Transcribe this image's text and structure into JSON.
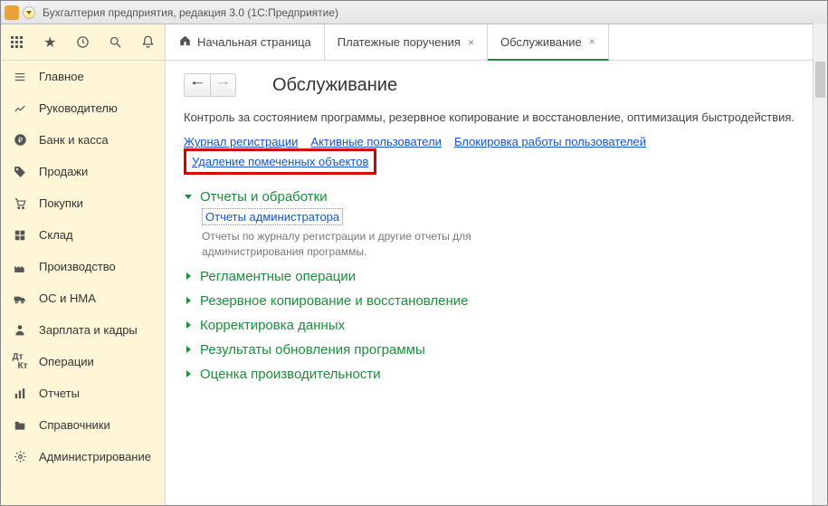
{
  "window": {
    "title": "Бухгалтерия предприятия, редакция 3.0   (1С:Предприятие)"
  },
  "sidebar": {
    "toolbar": [
      "apps",
      "star",
      "history",
      "search",
      "bell"
    ],
    "items": [
      {
        "icon": "menu",
        "label": "Главное"
      },
      {
        "icon": "chart",
        "label": "Руководителю"
      },
      {
        "icon": "ruble",
        "label": "Банк и касса"
      },
      {
        "icon": "tag",
        "label": "Продажи"
      },
      {
        "icon": "cart",
        "label": "Покупки"
      },
      {
        "icon": "boxes",
        "label": "Склад"
      },
      {
        "icon": "factory",
        "label": "Производство"
      },
      {
        "icon": "truck",
        "label": "ОС и НМА"
      },
      {
        "icon": "person",
        "label": "Зарплата и кадры"
      },
      {
        "icon": "dtkt",
        "label": "Операции"
      },
      {
        "icon": "bars",
        "label": "Отчеты"
      },
      {
        "icon": "folder",
        "label": "Справочники"
      },
      {
        "icon": "gear",
        "label": "Администрирование"
      }
    ]
  },
  "tabs": [
    {
      "label": "Начальная страница",
      "home": true,
      "closable": false,
      "active": false
    },
    {
      "label": "Платежные поручения",
      "closable": true,
      "active": false
    },
    {
      "label": "Обслуживание",
      "closable": true,
      "active": true
    }
  ],
  "page": {
    "title": "Обслуживание",
    "description": "Контроль за состоянием программы, резервное копирование и восстановление, оптимизация быстродействия.",
    "top_links": [
      {
        "label": "Журнал регистрации"
      },
      {
        "label": "Активные пользователи"
      },
      {
        "label": "Блокировка работы пользователей"
      },
      {
        "label": "Удаление помеченных объектов",
        "highlight": true
      }
    ],
    "sections": [
      {
        "title": "Отчеты и обработки",
        "expanded": true,
        "sub_link": "Отчеты администратора",
        "sub_desc": "Отчеты по журналу регистрации и другие отчеты для администрирования программы."
      },
      {
        "title": "Регламентные операции",
        "expanded": false
      },
      {
        "title": "Резервное копирование и восстановление",
        "expanded": false
      },
      {
        "title": "Корректировка данных",
        "expanded": false
      },
      {
        "title": "Результаты обновления программы",
        "expanded": false
      },
      {
        "title": "Оценка производительности",
        "expanded": false
      }
    ]
  }
}
